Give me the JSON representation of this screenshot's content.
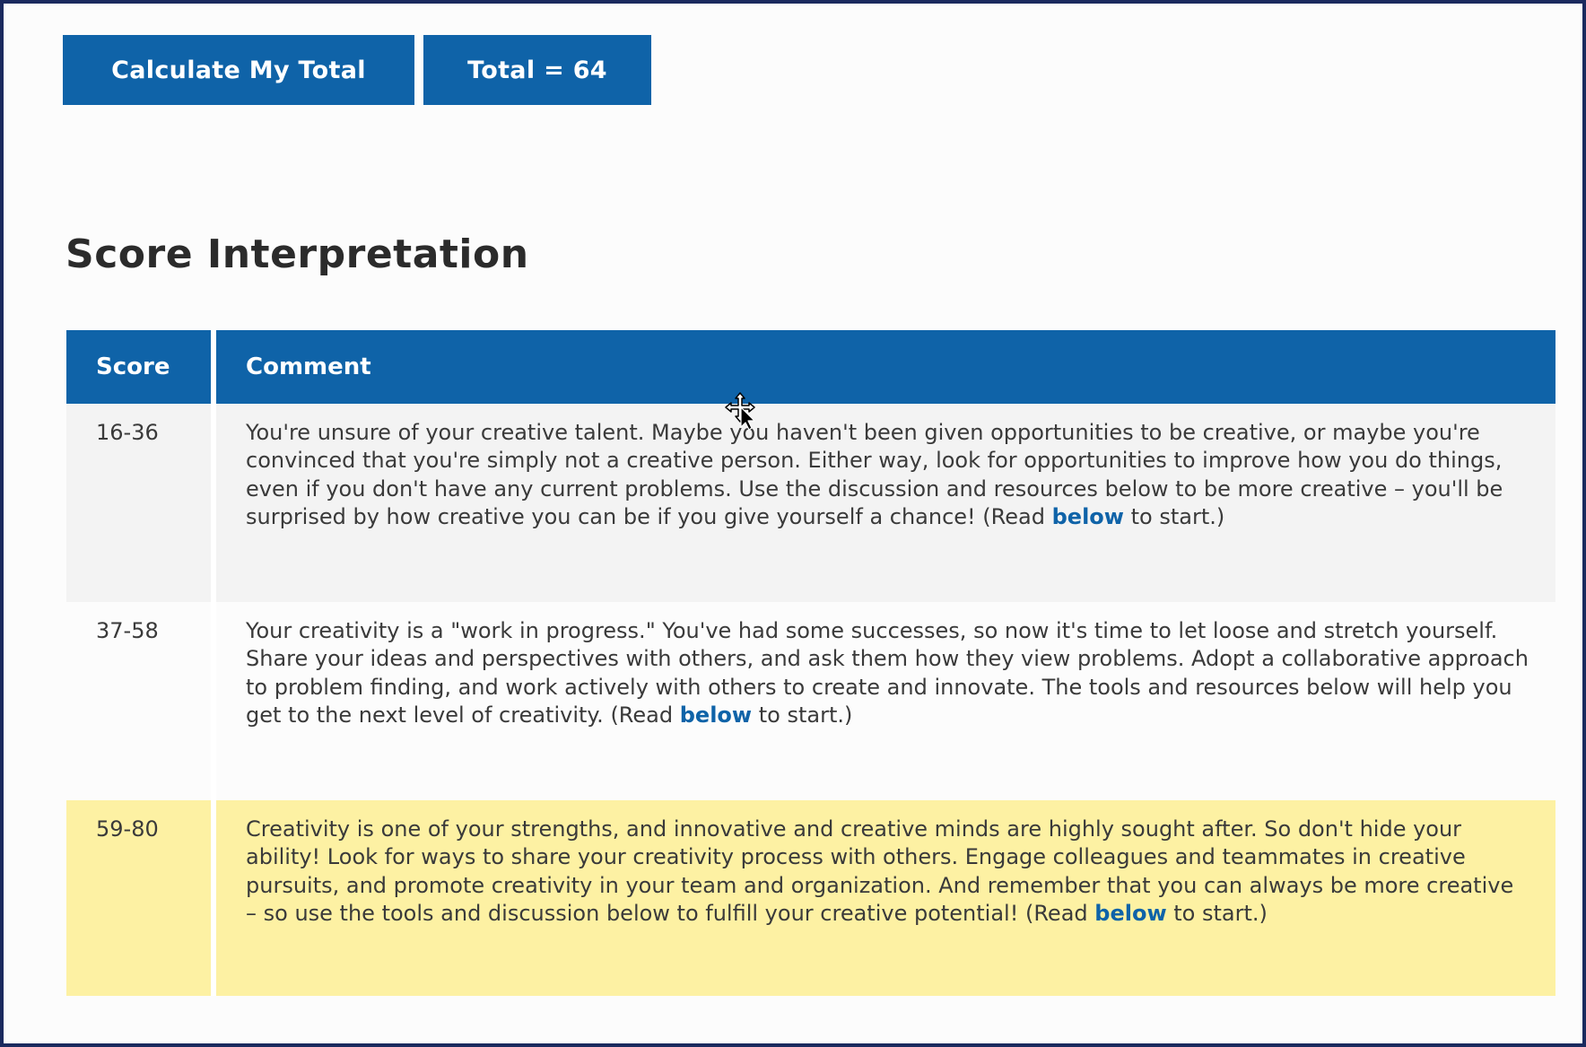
{
  "buttons": {
    "calculate_label": "Calculate My Total",
    "total_label": "Total = 64"
  },
  "heading": "Score Interpretation",
  "table": {
    "headers": {
      "score": "Score",
      "comment": "Comment"
    },
    "rows": [
      {
        "score": "16-36",
        "comment": "You're unsure of your creative talent. Maybe you haven't been given opportunities to be creative, or maybe you're convinced that you're simply not a creative person. Either way, look for opportunities to improve how you do things, even if you don't have any current problems. Use the discussion and resources below to be more creative – you'll be surprised by how creative you can be if you give yourself a chance! (Read",
        "link": "below",
        "suffix": "to start.)"
      },
      {
        "score": "37-58",
        "comment": "Your creativity is a \"work in progress.\" You've had some successes, so now it's time to let loose and stretch yourself. Share your ideas and perspectives with others, and ask them how they view problems. Adopt a collaborative approach to problem finding, and work actively with others to create and innovate. The tools and resources below will help you get to the next level of creativity. (Read",
        "link": "below",
        "suffix": "to start.)"
      },
      {
        "score": "59-80",
        "comment": "Creativity is one of your strengths, and innovative and creative minds are highly sought after. So don't hide your ability! Look for ways to share your creativity process with others. Engage colleagues and teammates in creative pursuits, and promote creativity in your team and organization. And remember that you can always be more creative – so use the tools and discussion below to fulfill your creative potential! (Read",
        "link": "below",
        "suffix": "to start.)"
      }
    ]
  },
  "colors": {
    "accent": "#0f63a8",
    "highlight_row": "#fdf1a3",
    "alt_row": "#f3f3f3",
    "frame_border": "#1b2a5e"
  },
  "icons": {
    "cursor": "move-cursor-icon"
  }
}
